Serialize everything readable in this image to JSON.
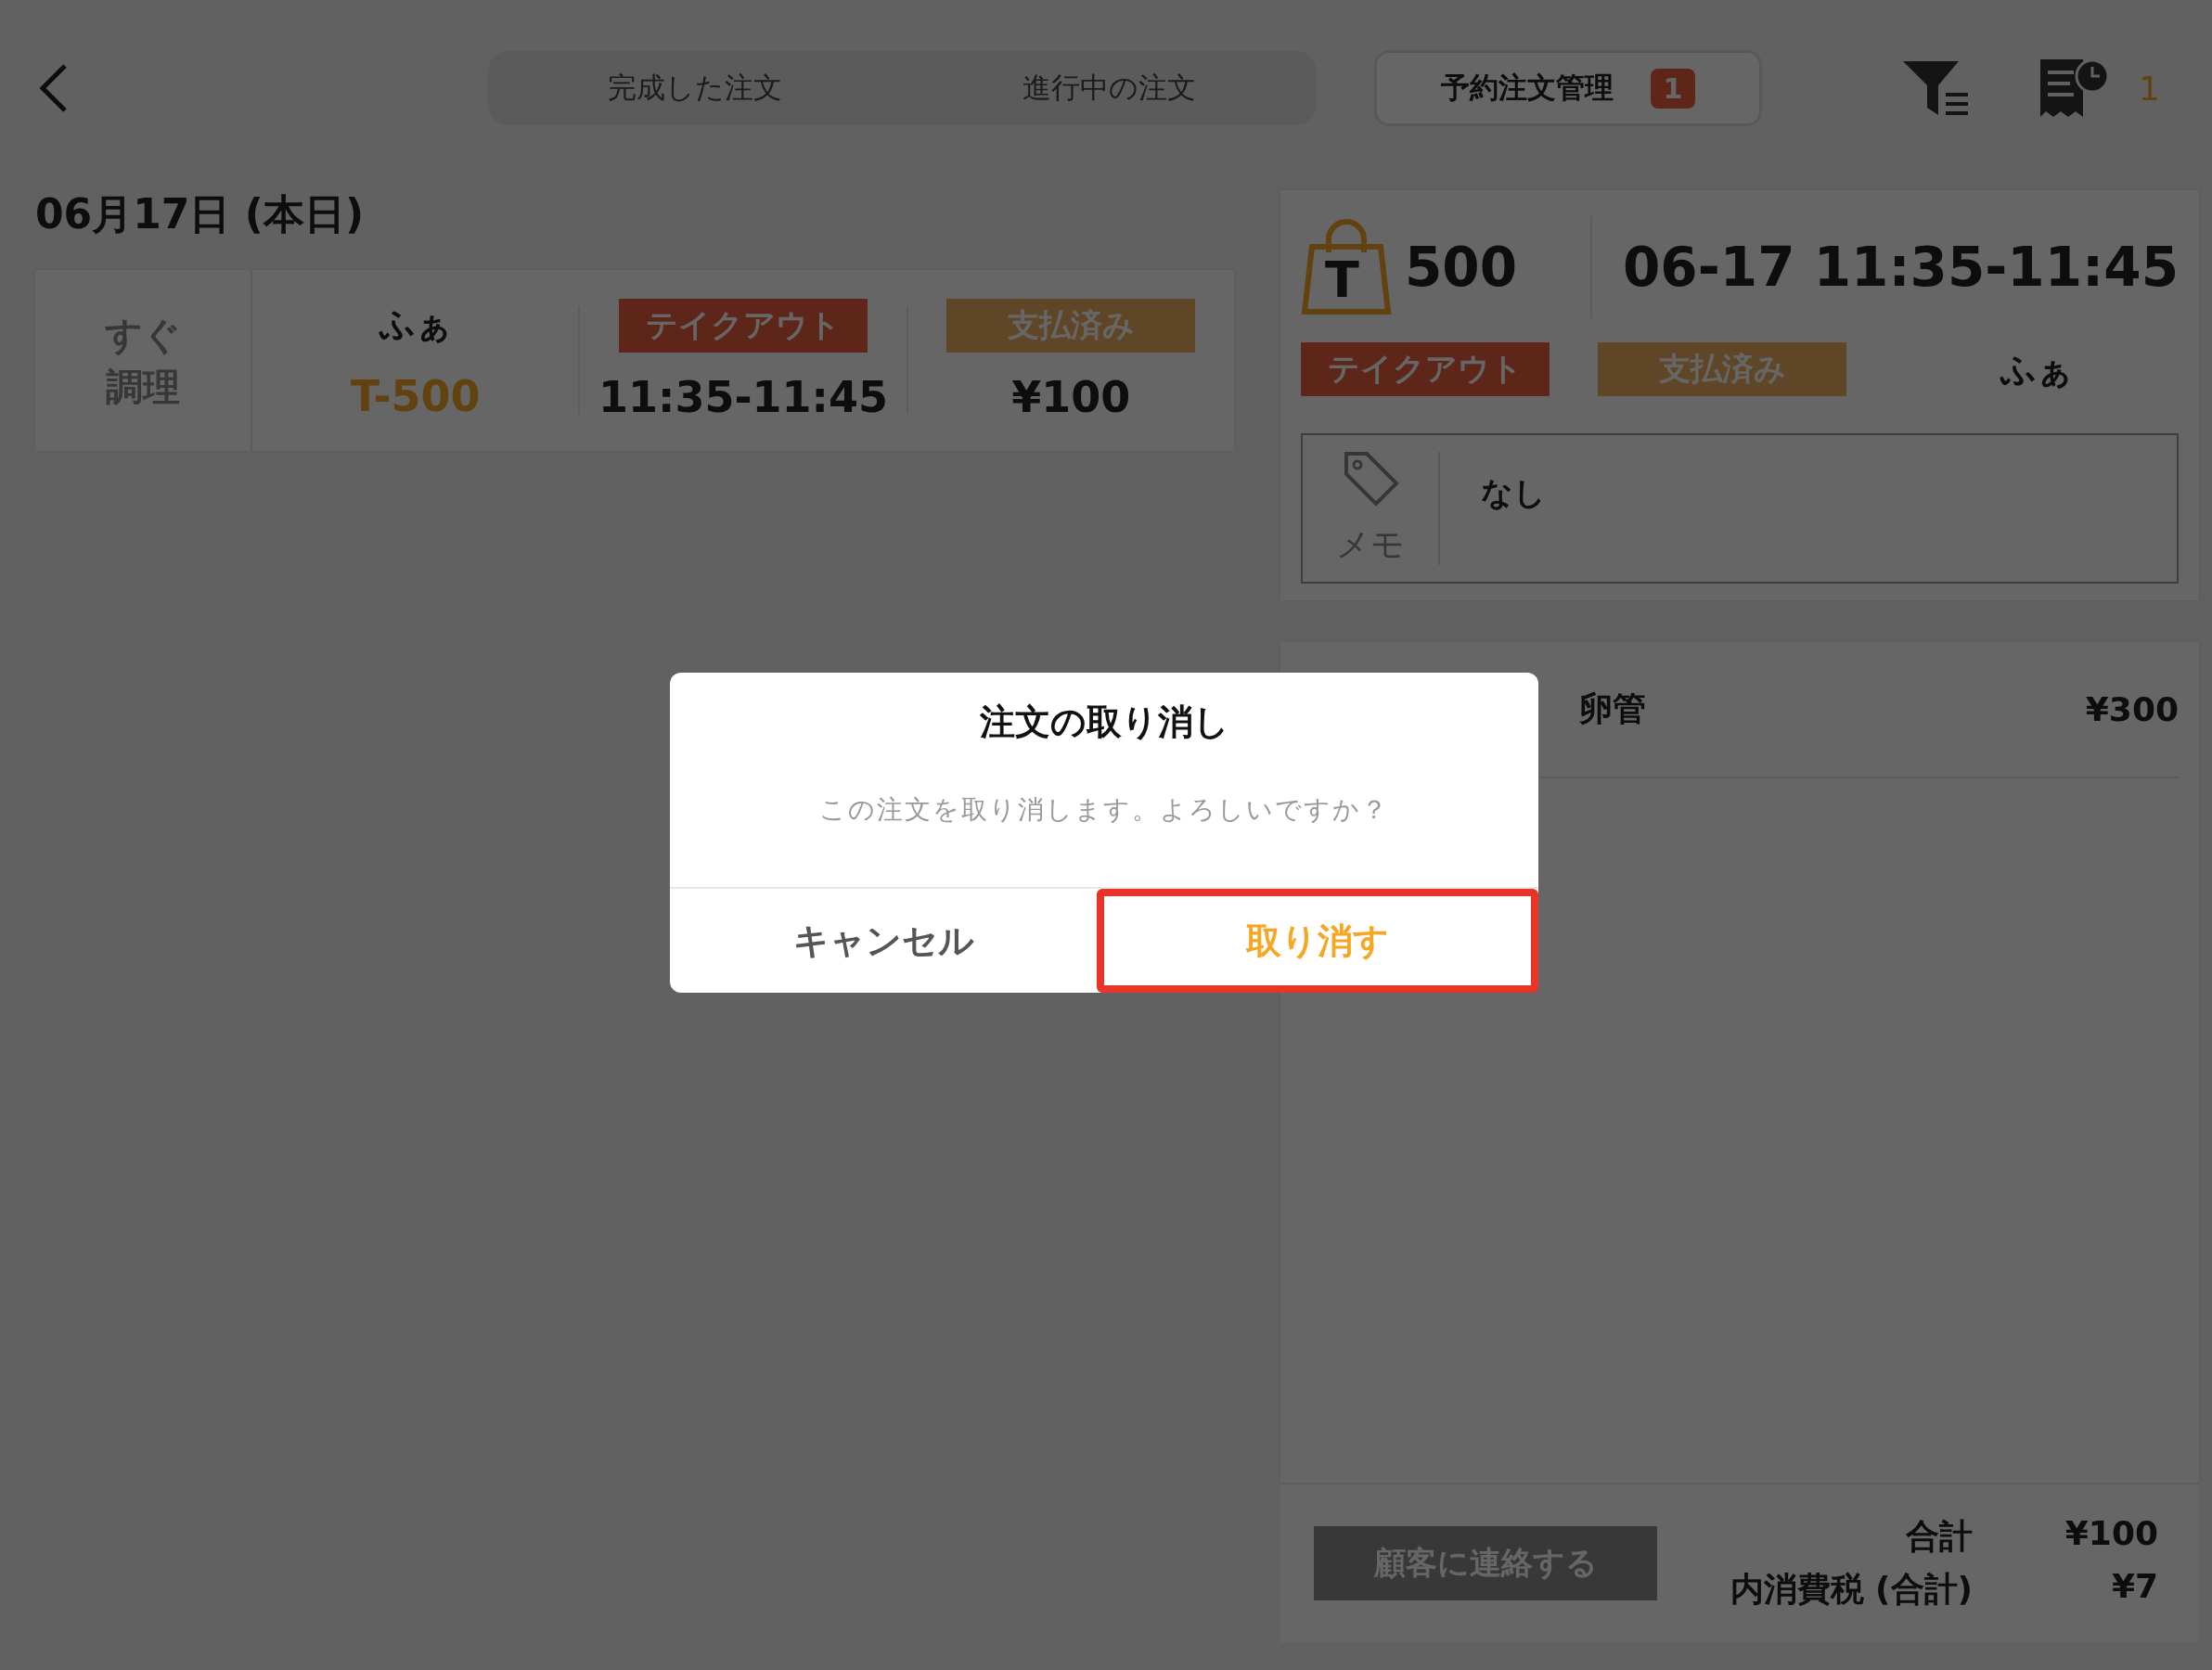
{
  "top_bar": {
    "tabs": [
      {
        "label": "完成した注文",
        "selected": false
      },
      {
        "label": "進行中の注文",
        "selected": false
      }
    ],
    "reservation_tab": {
      "label": "予約注文管理",
      "badge": "1",
      "selected": true
    },
    "pending_count": "1"
  },
  "date_heading": "06月17日 (本日)",
  "orders": [
    {
      "status": "すぐ調理",
      "customer": "ふぁ",
      "number": "T-500",
      "tags": [
        {
          "label": "テイクアウト",
          "kind": "takeout"
        },
        {
          "label": "支払済み",
          "kind": "paid"
        }
      ],
      "time": "11:35-11:45",
      "amount": "¥100"
    }
  ],
  "order_detail": {
    "bag_letter": "T",
    "number": "500",
    "time": "06-17 11:35-11:45",
    "tags": [
      {
        "label": "テイクアウト",
        "kind": "takeout"
      },
      {
        "label": "支払済み",
        "kind": "paid"
      }
    ],
    "customer": "ふぁ",
    "memo_label": "メモ",
    "memo": "なし",
    "items": [
      {
        "name": "卵管",
        "price": "¥300"
      }
    ],
    "contact_button": {
      "label": "顧客に連絡する",
      "disabled": true
    },
    "totals": [
      {
        "label": "合計",
        "value": "¥100"
      },
      {
        "label": "内消費税 (合計)",
        "value": "¥7"
      }
    ]
  },
  "dialog": {
    "title": "注文の取り消し",
    "message": "この注文を取り消します。よろしいですか？",
    "buttons": [
      {
        "label": "キャンセル",
        "kind": "cancel",
        "highlighted": false
      },
      {
        "label": "取り消す",
        "kind": "confirm",
        "highlighted": true
      }
    ]
  }
}
